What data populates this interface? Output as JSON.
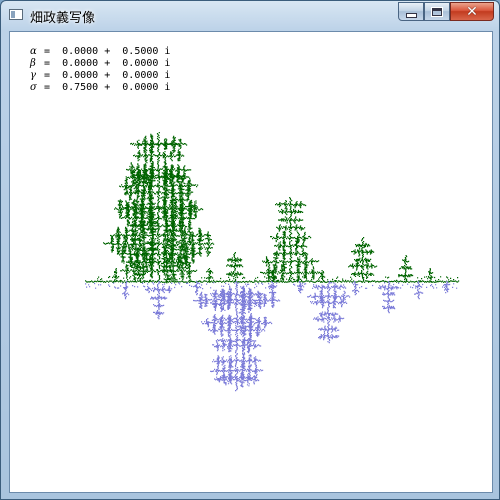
{
  "window": {
    "title": "畑政義写像",
    "controls": {
      "minimize": "minimize",
      "maximize": "maximize",
      "close": "close"
    }
  },
  "params": [
    {
      "symbol": "α",
      "real": "0.0000",
      "imag": "0.5000"
    },
    {
      "symbol": "β",
      "real": "0.0000",
      "imag": "0.0000"
    },
    {
      "symbol": "γ",
      "real": "0.0000",
      "imag": "0.0000"
    },
    {
      "symbol": "σ",
      "real": "0.7500",
      "imag": "0.0000"
    }
  ],
  "colors": {
    "upper_fractal": "#006400",
    "lower_fractal": "#7b7bd8",
    "axis": "#1a7a1a"
  }
}
